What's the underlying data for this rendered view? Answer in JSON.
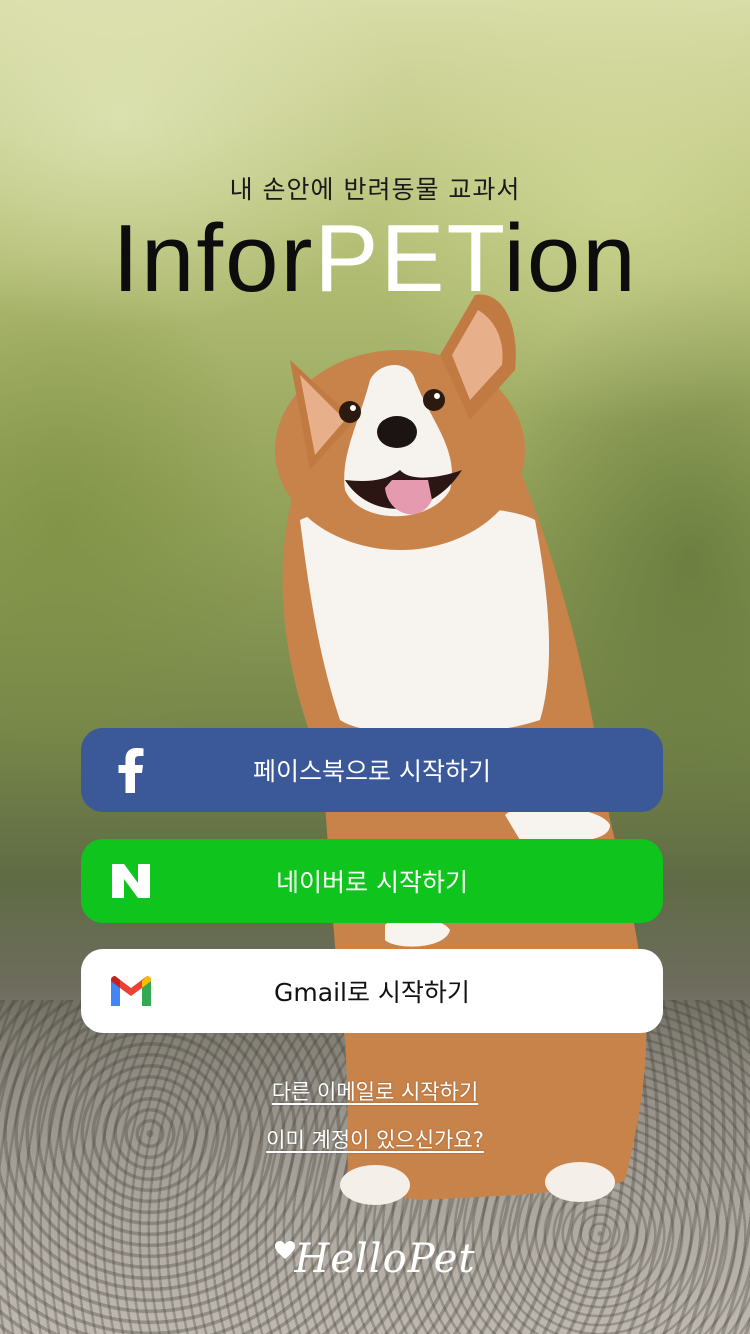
{
  "header": {
    "tagline": "내 손안에 반려동물 교과서",
    "title_prefix": "Infor",
    "title_highlight": "PET",
    "title_suffix": "ion"
  },
  "buttons": {
    "facebook": {
      "label": "페이스북으로 시작하기",
      "icon": "facebook-icon",
      "color": "#3b5998"
    },
    "naver": {
      "label": "네이버로 시작하기",
      "icon": "naver-icon",
      "color": "#0fc41c"
    },
    "gmail": {
      "label": "Gmail로 시작하기",
      "icon": "gmail-icon",
      "color": "#ffffff"
    }
  },
  "links": {
    "other_email": "다른 이메일로 시작하기",
    "have_account": "이미 계정이 있으신가요?"
  },
  "footer": {
    "brand": "HelloPet",
    "brand_icon": "heart-icon"
  }
}
